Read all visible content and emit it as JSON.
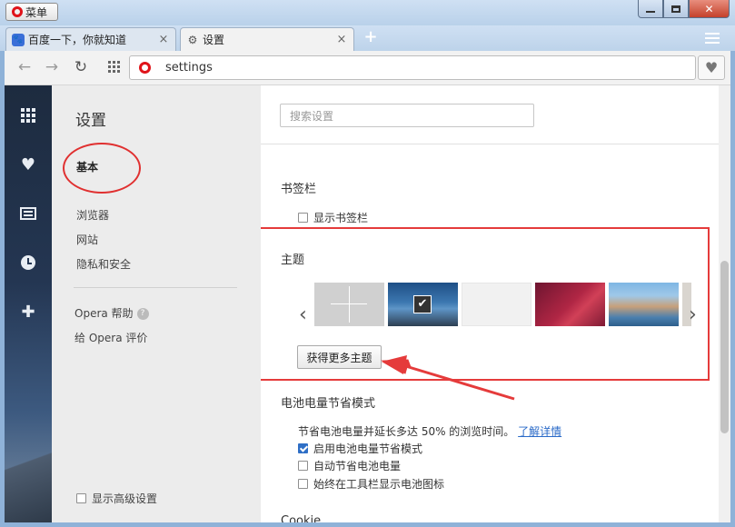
{
  "titlebar": {
    "menu_label": "菜单"
  },
  "tabs": [
    {
      "title": "百度一下，你就知道",
      "close": "×"
    },
    {
      "title": "设置",
      "close": "×"
    }
  ],
  "toolbar": {
    "address": "settings"
  },
  "sidebar_icons": [
    "speed-dial-icon",
    "heart-icon",
    "news-icon",
    "history-icon",
    "extensions-icon"
  ],
  "nav": {
    "title": "设置",
    "basic": "基本",
    "items": [
      "浏览器",
      "网站",
      "隐私和安全"
    ],
    "help": "Opera 帮助",
    "rate": "给 Opera 评价",
    "advanced": "显示高级设置"
  },
  "main": {
    "search_placeholder": "搜索设置",
    "bookmarks": {
      "title": "书签栏",
      "show_bar": "显示书签栏"
    },
    "themes": {
      "title": "主题",
      "get_more": "获得更多主题"
    },
    "battery": {
      "title": "电池电量节省模式",
      "desc": "节省电池电量并延长多达 50% 的浏览时间。",
      "learn_more": "了解详情",
      "options": [
        {
          "label": "启用电池电量节省模式",
          "checked": true
        },
        {
          "label": "自动节省电池电量",
          "checked": false
        },
        {
          "label": "始终在工具栏显示电池图标",
          "checked": false
        }
      ]
    },
    "next_section": "Cookie"
  },
  "colors": {
    "annotation_red": "#e53b3b",
    "opera_red": "#e0141a",
    "link": "#2a6ac8"
  }
}
